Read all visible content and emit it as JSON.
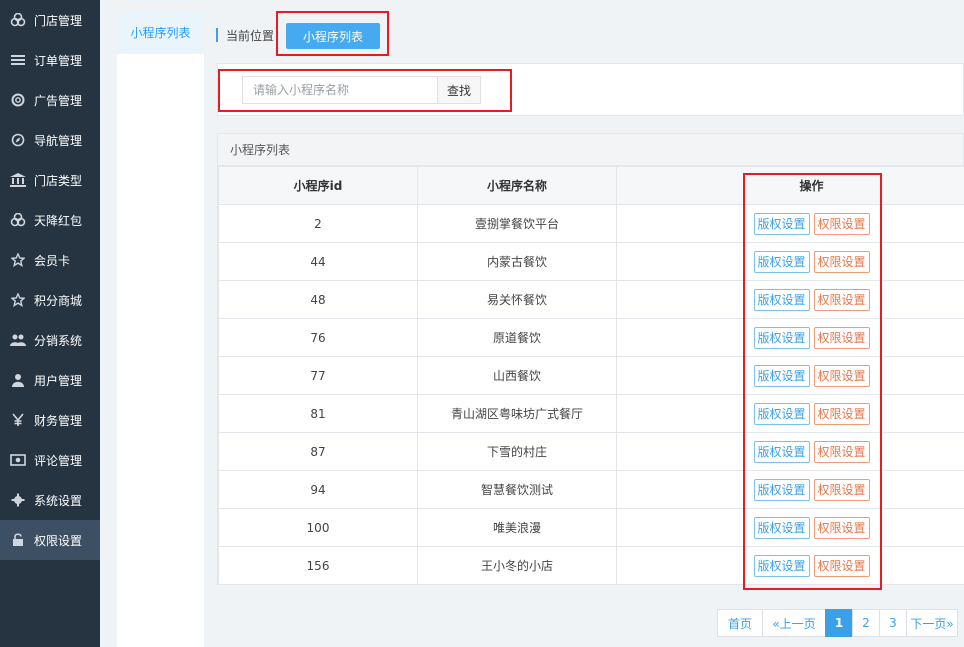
{
  "sidebar": {
    "items": [
      {
        "label": "门店管理",
        "icon": "store-group-icon"
      },
      {
        "label": "订单管理",
        "icon": "list-icon"
      },
      {
        "label": "广告管理",
        "icon": "lifebuoy-icon"
      },
      {
        "label": "导航管理",
        "icon": "compass-icon"
      },
      {
        "label": "门店类型",
        "icon": "bank-icon"
      },
      {
        "label": "天降红包",
        "icon": "store-group-icon"
      },
      {
        "label": "会员卡",
        "icon": "star-icon"
      },
      {
        "label": "积分商城",
        "icon": "star-icon"
      },
      {
        "label": "分销系统",
        "icon": "users-icon"
      },
      {
        "label": "用户管理",
        "icon": "user-icon"
      },
      {
        "label": "财务管理",
        "icon": "yen-icon"
      },
      {
        "label": "评论管理",
        "icon": "money-icon"
      },
      {
        "label": "系统设置",
        "icon": "gear-icon"
      },
      {
        "label": "权限设置",
        "icon": "unlock-icon",
        "active": true
      }
    ]
  },
  "subnav": {
    "item": "小程序列表"
  },
  "breadcrumb": {
    "label": "当前位置",
    "current": "小程序列表"
  },
  "search": {
    "placeholder": "请输入小程序名称",
    "value": "",
    "button": "查找"
  },
  "table": {
    "panel_title": "小程序列表",
    "columns": [
      "小程序id",
      "小程序名称",
      "",
      "操作"
    ],
    "action_labels": {
      "copyright": "版权设置",
      "permission": "权限设置"
    },
    "rows": [
      {
        "id": "2",
        "name": "壹捌掌餐饮平台"
      },
      {
        "id": "44",
        "name": "内蒙古餐饮"
      },
      {
        "id": "48",
        "name": "易关怀餐饮"
      },
      {
        "id": "76",
        "name": "原道餐饮"
      },
      {
        "id": "77",
        "name": "山西餐饮"
      },
      {
        "id": "81",
        "name": "青山湖区粤味坊广式餐厅"
      },
      {
        "id": "87",
        "name": "下雪的村庄"
      },
      {
        "id": "94",
        "name": "智慧餐饮测试"
      },
      {
        "id": "100",
        "name": "唯美浪漫"
      },
      {
        "id": "156",
        "name": "王小冬的小店"
      }
    ]
  },
  "pagination": {
    "first": "首页",
    "prev": "«上一页",
    "pages": [
      "1",
      "2",
      "3"
    ],
    "current": "1",
    "next": "下一页»"
  },
  "colors": {
    "sidebar_bg": "#263341",
    "accent": "#3aa0e8",
    "annotation_red": "#e51c23",
    "permission_orange": "#e8774a"
  }
}
